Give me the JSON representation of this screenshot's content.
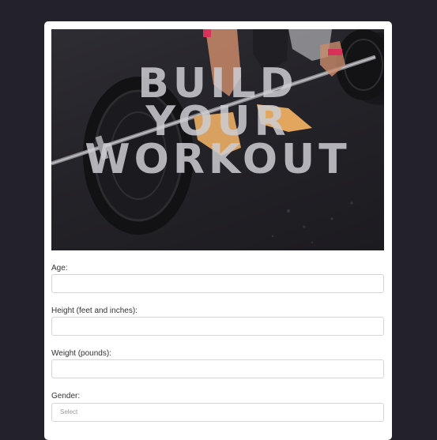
{
  "hero": {
    "title_lines": [
      "BUILD",
      "YOUR",
      "WORKOUT"
    ]
  },
  "form": {
    "age_label": "Age:",
    "height_label": "Height (feet and inches):",
    "weight_label": "Weight (pounds):",
    "gender_label": "Gender:",
    "gender_placeholder": "Select"
  },
  "colors": {
    "background": "#232129",
    "card": "#ffffff",
    "input_border": "#d6d6d6"
  }
}
